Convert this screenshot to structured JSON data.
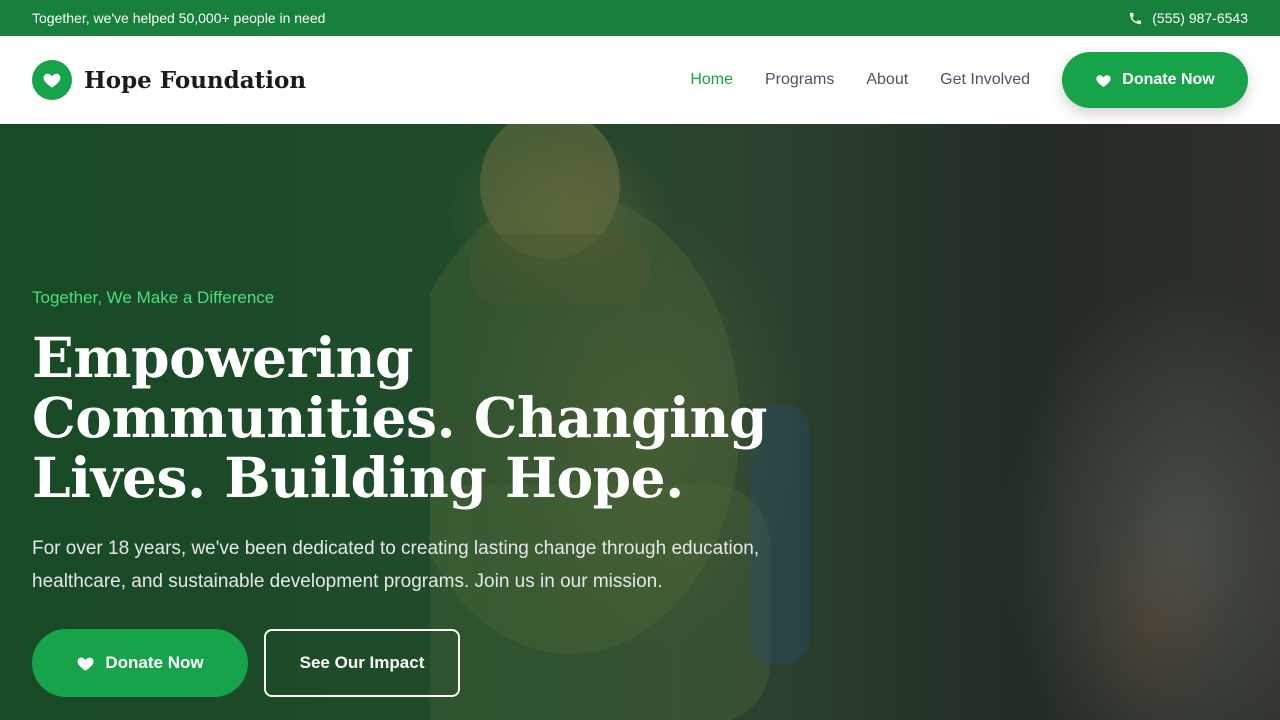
{
  "topbar": {
    "message": "Together, we've helped 50,000+ people in need",
    "phone": "(555) 987-6543",
    "phone_icon": "phone-icon"
  },
  "header": {
    "brand_name": "Hope Foundation",
    "logo_icon": "heart-icon",
    "nav": [
      {
        "label": "Home",
        "active": true
      },
      {
        "label": "Programs",
        "active": false
      },
      {
        "label": "About",
        "active": false
      },
      {
        "label": "Get Involved",
        "active": false
      }
    ],
    "donate_label": "Donate Now"
  },
  "hero": {
    "eyebrow": "Together, We Make a Difference",
    "headline_lines": [
      "Empowering",
      "Communities. Changing",
      "Lives. Building Hope."
    ],
    "lede_lines": [
      "For over 18 years, we've been dedicated to creating lasting change through education,",
      "healthcare, and sustainable development programs. Join us in our mission."
    ],
    "primary_cta": "Donate Now",
    "secondary_cta": "See Our Impact"
  },
  "colors": {
    "brand_green": "#16a34a",
    "topbar_green": "#16803c",
    "accent_light_green": "#4ade80",
    "nav_text": "#4b5563"
  }
}
